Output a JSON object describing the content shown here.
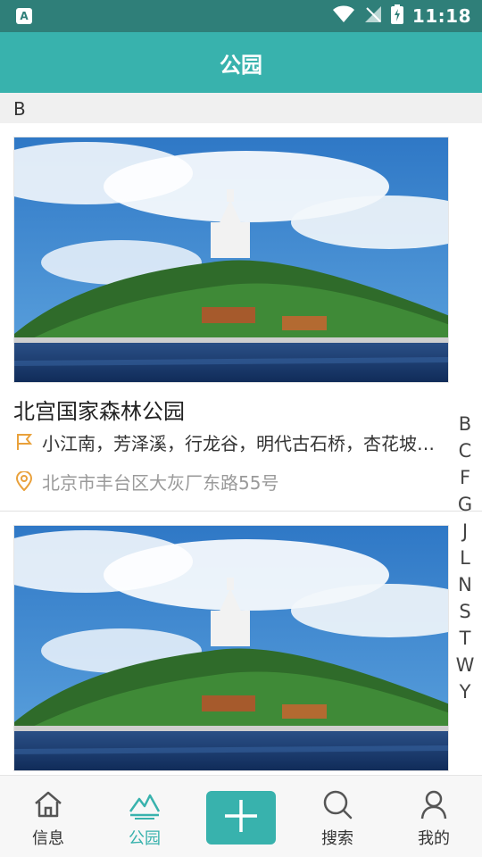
{
  "status_bar": {
    "left_icon": "app-a-icon",
    "left_label": "A",
    "time": "11:18",
    "icons": [
      "wifi-icon",
      "signal-off-icon",
      "battery-charging-icon"
    ]
  },
  "header": {
    "title": "公园"
  },
  "section": {
    "letter": "B"
  },
  "parks": [
    {
      "name": "北宫国家森林公园",
      "attractions": "小江南，芳泽溪，行龙谷，明代古石桥，杏花坡…",
      "address": "北京市丰台区大灰厂东路55号",
      "photo_icon": "park-photo-image"
    },
    {
      "photo_icon": "park-photo-image"
    }
  ],
  "index_letters": [
    "B",
    "C",
    "F",
    "G",
    "J",
    "L",
    "N",
    "S",
    "T",
    "W",
    "Y"
  ],
  "bottom_nav": {
    "items": [
      {
        "label": "信息",
        "icon": "home-icon"
      },
      {
        "label": "公园",
        "icon": "park-icon",
        "active": true
      },
      {
        "label": "",
        "icon": "plus-icon"
      },
      {
        "label": "搜索",
        "icon": "search-icon"
      },
      {
        "label": "我的",
        "icon": "user-icon"
      }
    ]
  },
  "colors": {
    "status_bar": "#2f7f79",
    "header": "#38b2ad",
    "accent": "#38b2ad",
    "flag_icon": "#e9a13b",
    "location_icon": "#e9a13b"
  }
}
